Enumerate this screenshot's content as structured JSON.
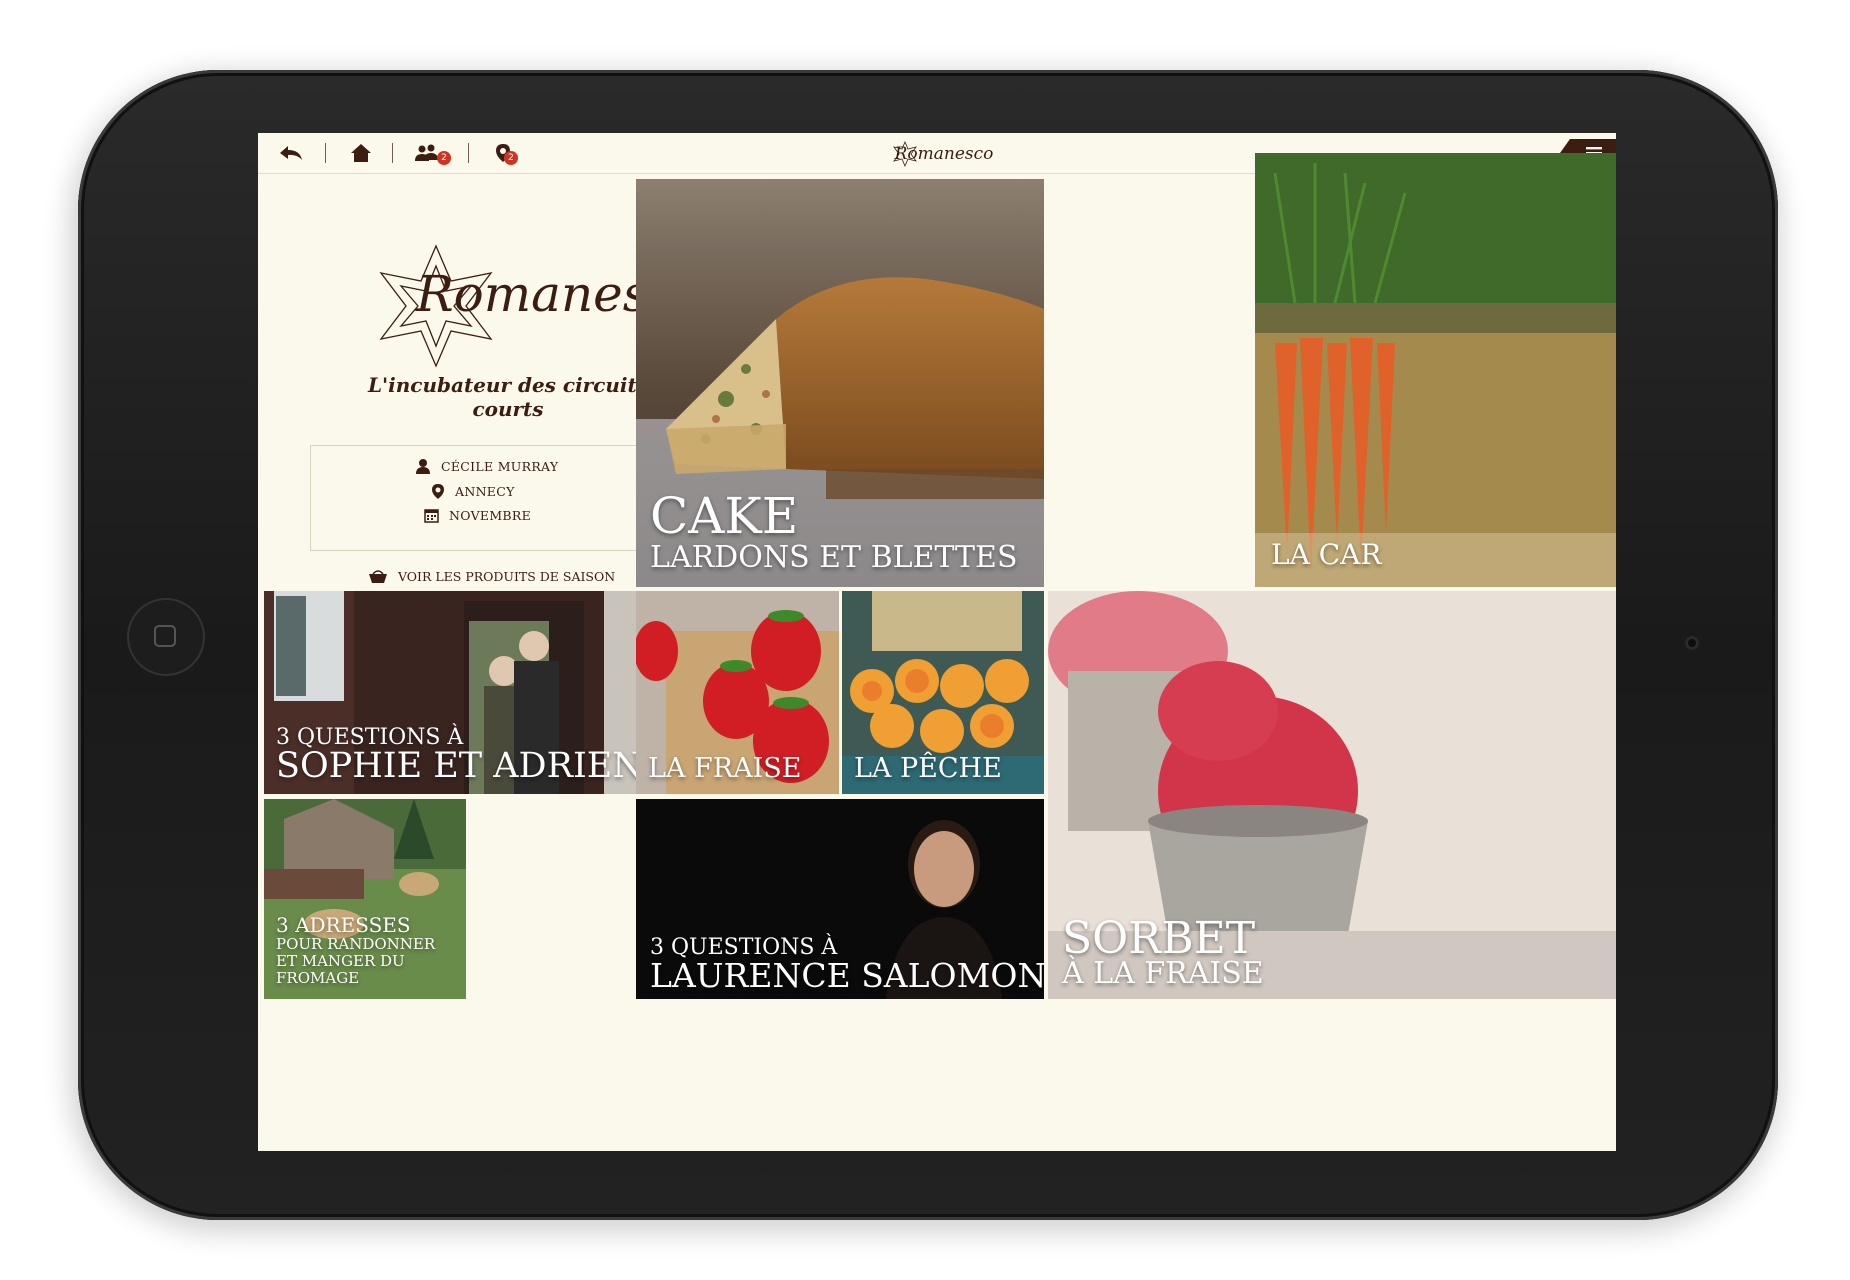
{
  "app": {
    "name": "Romanesco",
    "tagline": "L'incubateur des circuits courts"
  },
  "nav": {
    "back_icon": "back-arrow-icon",
    "home_icon": "home-icon",
    "friends_icon": "people-icon",
    "friends_badge": "2",
    "places_icon": "map-pin-icon",
    "places_badge": "2",
    "menu_icon": "hamburger-menu-icon",
    "logo_text": "Romanesco"
  },
  "profile": {
    "user": "CÉCILE MURRAY",
    "location": "ANNECY",
    "month": "NOVEMBRE"
  },
  "season_link": "VOIR LES PRODUITS  DE SAISON",
  "tiles": {
    "cake": {
      "title": "CAKE",
      "subtitle": "LARDONS ET BLETTES"
    },
    "carrot": {
      "title": "LA CAR"
    },
    "sophie": {
      "line1": "3 QUESTIONS À",
      "line2": "SOPHIE ET ADRIEN"
    },
    "fraise": {
      "title": "LA FRAISE"
    },
    "peche": {
      "title": "LA PÊCHE"
    },
    "sorbet": {
      "line1": "SORBET",
      "line2": "À LA FRAISE"
    },
    "adresses": {
      "line1": "3 ADRESSES",
      "line2": "POUR RANDONNER",
      "line3": "ET MANGER DU",
      "line4": "FROMAGE"
    },
    "laurence": {
      "line1": "3 QUESTIONS À",
      "line2": "LAURENCE SALOMON"
    }
  },
  "colors": {
    "brand_brown": "#3b1d12",
    "badge_red": "#d0331f",
    "background": "#fbf8ec"
  }
}
